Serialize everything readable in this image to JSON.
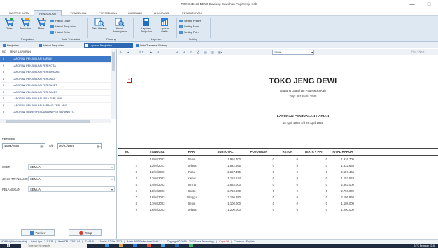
{
  "window": {
    "title": "TOKO JENG DEWI-Dawung Dawuhan Pagerwojo Kab",
    "controls": [
      "—",
      "□"
    ]
  },
  "menu_tabs": [
    "MASTER DATA",
    "PENJUALAN",
    "PEMBELIAN",
    "PERSEDIAAN",
    "KAS BANK",
    "AKUNTANSI",
    "PENGATURAN"
  ],
  "ribbon": {
    "penjualan_group": {
      "buttons": [
        "Order",
        "Penjualan",
        "Retur"
      ],
      "history_items": [
        "Histori Order",
        "Histori Penjualan",
        "Histori Retur"
      ],
      "label": "Penjualan",
      "transaksi_label": "Data Transaksi"
    },
    "piutang_group": {
      "buttons": [
        "Data Piutang",
        "Histori Pembayaran"
      ],
      "label": "Piutang"
    },
    "laporan_group": {
      "buttons": [
        "Laporan Penjualan",
        "Laporan Grafik"
      ],
      "label": "Laporan"
    },
    "setting_group": {
      "items": [
        "Setting Printer",
        "Setting Nota",
        "Setting Poin"
      ],
      "label": "Setting"
    }
  },
  "doc_tabs": [
    "Penjualan",
    "Histori Penjualan",
    "Laporan Penjualan",
    "Data Transaksi Piutang"
  ],
  "report_list": {
    "headers": {
      "no": "NO",
      "name": "JENIS LAPORAN"
    },
    "rows": [
      {
        "no": "1",
        "name": "LAPORAN PENJUALAN HARIAN"
      },
      {
        "no": "2",
        "name": "LAPORAN PENJUALAN PER NOTA"
      },
      {
        "no": "3",
        "name": "LAPORAN PENJUALAN PER BARANG"
      },
      {
        "no": "4",
        "name": "LAPORAN PENJUALAN PER JASA"
      },
      {
        "no": "5",
        "name": "LAPORAN PENJUALAN PER PAKET"
      },
      {
        "no": "6",
        "name": "LAPORAN PENJUALAN PER SALES"
      },
      {
        "no": "7",
        "name": "LAPORAN PENJUALAN JASA TERLARIS"
      },
      {
        "no": "8",
        "name": "LAPORAN PENJUALAN BARANG TERLARIS"
      },
      {
        "no": "9",
        "name": "LAPORAN ORDER PENJUALAN PER BARANG (I..."
      }
    ]
  },
  "filters": {
    "periode_label": "PERIODE",
    "date_from": "10/04/2023",
    "sd_label": "S/d",
    "date_to": "25/04/2023",
    "user_label": "USER",
    "user_value": "SEMUA",
    "jenis_label": "JENIS TRANSAKSI",
    "jenis_value": "SEMUA",
    "pelanggan_label": "PELANGGAN",
    "pelanggan_value": "SEMUA"
  },
  "buttons": {
    "preview": "Preview",
    "tutup": "Tutup"
  },
  "viewer_toolbar": {
    "first": "H",
    "prev": "◄",
    "page_of": "of 1",
    "next": "►",
    "last": "H",
    "zoom": "100%",
    "find": "Find",
    "next_label": "Next"
  },
  "report": {
    "store_name": "TOKO JENG DEWI",
    "address": "Dawung Dawuhan Pagerwojo Kab",
    "phone": "Telp: 081554517945",
    "title": "LAPORAN PENJUALAN HARIAN",
    "period": "10 April 2023 s/d 25 April 2023",
    "columns": [
      "NO",
      "TANGGAL",
      "HARI",
      "SUBTOTAL",
      "POTONGAN",
      "RETUR",
      "BIAYA + PPn",
      "TOTAL HARGA"
    ],
    "rows": [
      [
        "1",
        "10/04/2023",
        "Senin",
        "1.916.700",
        "0",
        "0",
        "0",
        "1.916.700"
      ],
      [
        "2",
        "11/04/2023",
        "Selasa",
        "1.832.665",
        "0",
        "0",
        "0",
        "1.832.665"
      ],
      [
        "3",
        "12/04/2023",
        "Rabu",
        "2.557.455",
        "0",
        "0",
        "0",
        "2.557.455"
      ],
      [
        "4",
        "13/04/2023",
        "Kamis",
        "1.153.524",
        "0",
        "0",
        "0",
        "1.153.524"
      ],
      [
        "5",
        "14/04/2023",
        "Jum'at",
        "2.863.000",
        "0",
        "0",
        "0",
        "2.863.000"
      ],
      [
        "6",
        "15/04/2023",
        "Sabtu",
        "2.793.000",
        "0",
        "0",
        "0",
        "2.793.000"
      ],
      [
        "7",
        "16/04/2023",
        "Minggu",
        "2.196.850",
        "0",
        "0",
        "0",
        "2.196.850"
      ],
      [
        "8",
        "17/04/2023",
        "Senin",
        "1.108.000",
        "0",
        "0",
        "0",
        "1.108.000"
      ],
      [
        "9",
        "18/04/2023",
        "Selasa",
        "1.200.000",
        "0",
        "0",
        "0",
        "1.200.000"
      ]
    ]
  },
  "statusbar": [
    "ADMIN (Administrator)",
    "Versi App : 3.1.1.28",
    "Versi DB : 23.01.04",
    "22:48:48",
    "Jum'at, 12 Mei 2023",
    "Arata POS Profesional Build 3.1.1 - Copyright © 2019 - 2023 Arata Technology",
    "Caps Off",
    "Currency : English"
  ],
  "taskbar": {
    "search_placeholder": "Type here to search",
    "weather": "24°C Berawan",
    "clock": "22:48"
  },
  "colors": {
    "ribbon_bg": "#dde8f3",
    "selected_row": "#3d79c8",
    "active_tab": "#2b67b3",
    "taskbar": "#1e2b3f"
  }
}
